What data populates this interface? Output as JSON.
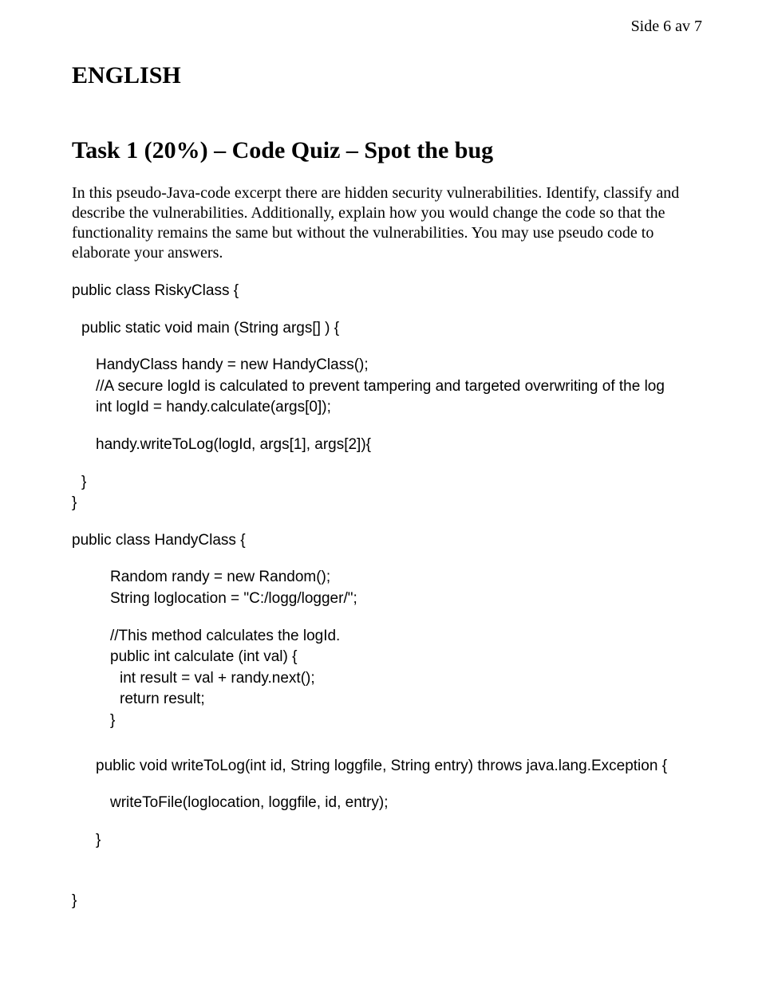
{
  "header": {
    "page_num": "Side 6 av 7"
  },
  "heading": {
    "english": "ENGLISH",
    "task_title": "Task 1 (20%) – Code Quiz – Spot the bug"
  },
  "paragraph": "In this pseudo-Java-code excerpt there are hidden security vulnerabilities. Identify, classify and describe the vulnerabilities. Additionally, explain how you would change the code so that the functionality remains the same but without the vulnerabilities. You may use pseudo code to elaborate your answers.",
  "code": {
    "l1": "public class RiskyClass {",
    "l2": "public static void main (String args[] ) {",
    "l3": "HandyClass handy = new HandyClass();",
    "l4": "//A secure logId is calculated to prevent tampering and targeted overwriting of the log",
    "l5": "int logId = handy.calculate(args[0]);",
    "l6": "handy.writeToLog(logId, args[1], args[2]){",
    "l7": "}",
    "l8": "}",
    "l9": "public class HandyClass {",
    "l10": "Random randy = new Random();",
    "l11": "String loglocation = \"C:/logg/logger/\";",
    "l12": "//This method calculates the logId.",
    "l13": "public int calculate (int val) {",
    "l14": "int result = val + randy.next();",
    "l15": "return result;",
    "l16": "}",
    "l17": "public void writeToLog(int id, String loggfile, String entry) throws java.lang.Exception {",
    "l18": "writeToFile(loglocation, loggfile, id, entry);",
    "l19": "}",
    "l20": "}"
  }
}
